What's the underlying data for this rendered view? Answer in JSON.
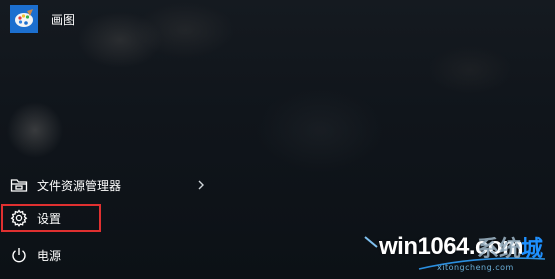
{
  "pinned_app": {
    "label": "画图",
    "icon": "paint-palette-icon",
    "tile_color": "#1c6fcf"
  },
  "menu": {
    "explorer_label": "文件资源管理器",
    "explorer_icon": "folder-icon",
    "settings_label": "设置",
    "settings_icon": "gear-icon",
    "power_label": "电源",
    "power_icon": "power-icon"
  },
  "highlight_color": "#e03030",
  "watermark": {
    "main": "win1064.com",
    "cn_1": "系",
    "cn_2": "统",
    "cn_3": "城",
    "sub": "xitongcheng.com"
  }
}
